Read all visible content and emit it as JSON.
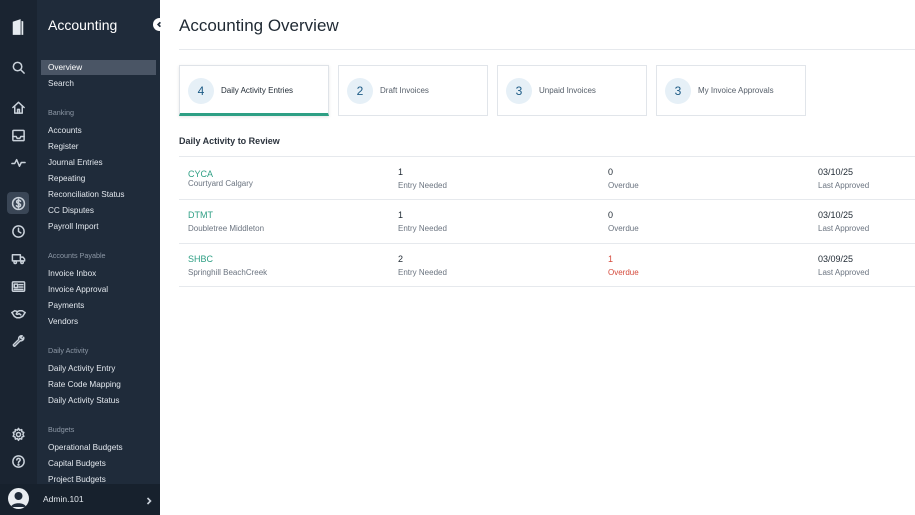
{
  "app": {
    "title": "Accounting"
  },
  "sidebar": {
    "items": [
      {
        "label": "Overview",
        "active": true
      },
      {
        "label": "Search"
      }
    ],
    "sections": [
      {
        "title": "Banking",
        "items": [
          "Accounts",
          "Register",
          "Journal Entries",
          "Repeating",
          "Reconciliation Status",
          "CC Disputes",
          "Payroll Import"
        ]
      },
      {
        "title": "Accounts Payable",
        "items": [
          "Invoice Inbox",
          "Invoice Approval",
          "Payments",
          "Vendors"
        ]
      },
      {
        "title": "Daily Activity",
        "items": [
          "Daily Activity Entry",
          "Rate Code Mapping",
          "Daily Activity Status"
        ]
      },
      {
        "title": "Budgets",
        "items": [
          "Operational Budgets",
          "Capital Budgets",
          "Project Budgets"
        ]
      }
    ]
  },
  "rail_icons": [
    "logo-icon",
    "search-icon",
    "home-icon",
    "inbox-icon",
    "activity-icon",
    "dollar-icon",
    "clock-icon",
    "truck-icon",
    "id-card-icon",
    "handshake-icon",
    "wrench-icon",
    "gear-icon",
    "help-icon"
  ],
  "user": {
    "name": "Admin.101"
  },
  "page": {
    "title": "Accounting Overview"
  },
  "cards": [
    {
      "count": "4",
      "label": "Daily Activity Entries",
      "active": true
    },
    {
      "count": "2",
      "label": "Draft Invoices"
    },
    {
      "count": "3",
      "label": "Unpaid Invoices"
    },
    {
      "count": "3",
      "label": "My Invoice Approvals"
    }
  ],
  "review": {
    "title": "Daily Activity to Review",
    "rows": [
      {
        "code": "CYCA",
        "name": "Courtyard Calgary",
        "entries": "1",
        "entries_label": "Entry Needed",
        "overdue": "0",
        "overdue_label": "Overdue",
        "date": "03/10/25",
        "date_label": "Last Approved"
      },
      {
        "code": "DTMT",
        "name": "Doubletree Middleton",
        "entries": "1",
        "entries_label": "Entry Needed",
        "overdue": "0",
        "overdue_label": "Overdue",
        "date": "03/10/25",
        "date_label": "Last Approved"
      },
      {
        "code": "SHBC",
        "name": "Springhill BeachCreek",
        "entries": "2",
        "entries_label": "Entry Needed",
        "overdue": "1",
        "overdue_label": "Overdue",
        "date": "03/09/25",
        "date_label": "Last Approved",
        "overdue_alert": true
      }
    ]
  },
  "colors": {
    "accent": "#2e9f84",
    "alert": "#d54b3d",
    "sidebar": "#1f2b3a",
    "rail": "#1a2431"
  }
}
